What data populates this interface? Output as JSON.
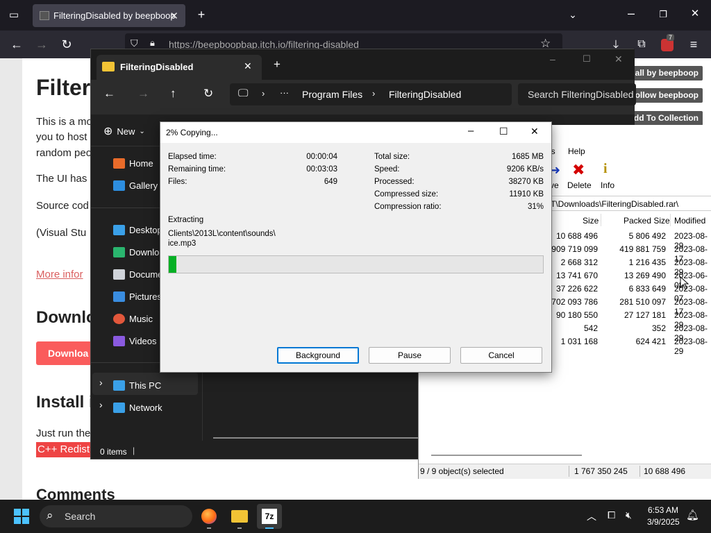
{
  "browser": {
    "tab_title": "FilteringDisabled by beepboop",
    "url": "https://beepboopbap.itch.io/filtering-disabled",
    "notification_count": "7"
  },
  "page": {
    "heading": "Filter",
    "intro_1": "This is a mo",
    "intro_2": "you to host",
    "intro_3": "random peo",
    "ui_line": "The UI has",
    "source_line": "Source cod",
    "vs_line": "(Visual Stu",
    "more_info": "More infor",
    "download_heading": "Downlo",
    "download_button": "Downloa",
    "install_heading": "Install i",
    "just_run": "Just run the",
    "redist": "C++ Redist",
    "comments_heading": "Comments",
    "view_all": "w all by beepboop",
    "follow": "Follow beepboop",
    "add_collection": "Add To Collection"
  },
  "explorer": {
    "tab_title": "FilteringDisabled",
    "breadcrumb": [
      "Program Files",
      "FilteringDisabled"
    ],
    "search_placeholder": "Search FilteringDisabled",
    "new_label": "New",
    "nav": [
      {
        "label": "Home",
        "color": "#e86b2a"
      },
      {
        "label": "Gallery",
        "color": "#2d8ee0"
      },
      {
        "label": "Desktop",
        "color": "#3aa0e8"
      },
      {
        "label": "Downloa",
        "color": "#2ab56e"
      },
      {
        "label": "Docume",
        "color": "#cfd3d9"
      },
      {
        "label": "Pictures",
        "color": "#3a8de0"
      },
      {
        "label": "Music",
        "color": "#e2573b"
      },
      {
        "label": "Videos",
        "color": "#8a5ae0"
      },
      {
        "label": "This PC",
        "color": "#3aa0e8"
      },
      {
        "label": "Network",
        "color": "#3aa0e8"
      }
    ],
    "status": "0 items"
  },
  "sevenzip": {
    "menu_visible": [
      "ls",
      "Help"
    ],
    "toolbar": [
      {
        "label": "ve"
      },
      {
        "label": "Delete"
      },
      {
        "label": "Info"
      }
    ],
    "path": "T\\Downloads\\FilteringDisabled.rar\\",
    "columns": [
      "Size",
      "Packed Size",
      "Modified"
    ],
    "rows": [
      {
        "size": "10 688 496",
        "packed": "5 806 492",
        "modified": "2023-08-29"
      },
      {
        "size": "909 719 099",
        "packed": "419 881 759",
        "modified": "2023-08-17"
      },
      {
        "size": "2 668 312",
        "packed": "1 216 435",
        "modified": "2023-08-29"
      },
      {
        "size": "13 741 670",
        "packed": "13 269 490",
        "modified": "2023-06-08"
      },
      {
        "size": "37 226 622",
        "packed": "6 833 649",
        "modified": "2023-08-07"
      },
      {
        "size": "702 093 786",
        "packed": "281 510 097",
        "modified": "2023-08-17"
      },
      {
        "size": "90 180 550",
        "packed": "27 127 181",
        "modified": "2023-08-29"
      },
      {
        "size": "542",
        "packed": "352",
        "modified": "2023-08-29"
      },
      {
        "size": "1 031 168",
        "packed": "624 421",
        "modified": "2023-08-29"
      }
    ],
    "status": {
      "selected": "9 / 9 object(s) selected",
      "total": "1 767 350 245",
      "item": "10 688 496"
    }
  },
  "copy_dialog": {
    "title": "2% Copying...",
    "progress_fraction": 0.02,
    "left_stats": [
      {
        "label": "Elapsed time:",
        "value": "00:00:04"
      },
      {
        "label": "Remaining time:",
        "value": "00:03:03"
      },
      {
        "label": "Files:",
        "value": "649"
      }
    ],
    "right_stats": [
      {
        "label": "Total size:",
        "value": "1685 MB"
      },
      {
        "label": "Speed:",
        "value": "9206 KB/s"
      },
      {
        "label": "Processed:",
        "value": "38270 KB"
      },
      {
        "label": "Compressed size:",
        "value": "11910 KB"
      },
      {
        "label": "Compression ratio:",
        "value": "31%"
      }
    ],
    "operation": "Extracting",
    "current_file_1": "Clients\\2013L\\content\\sounds\\",
    "current_file_2": "ice.mp3",
    "buttons": {
      "background": "Background",
      "pause": "Pause",
      "cancel": "Cancel"
    }
  },
  "taskbar": {
    "search_label": "Search",
    "time": "6:53 AM",
    "date": "3/9/2025",
    "seven_zip_label": "7z"
  }
}
